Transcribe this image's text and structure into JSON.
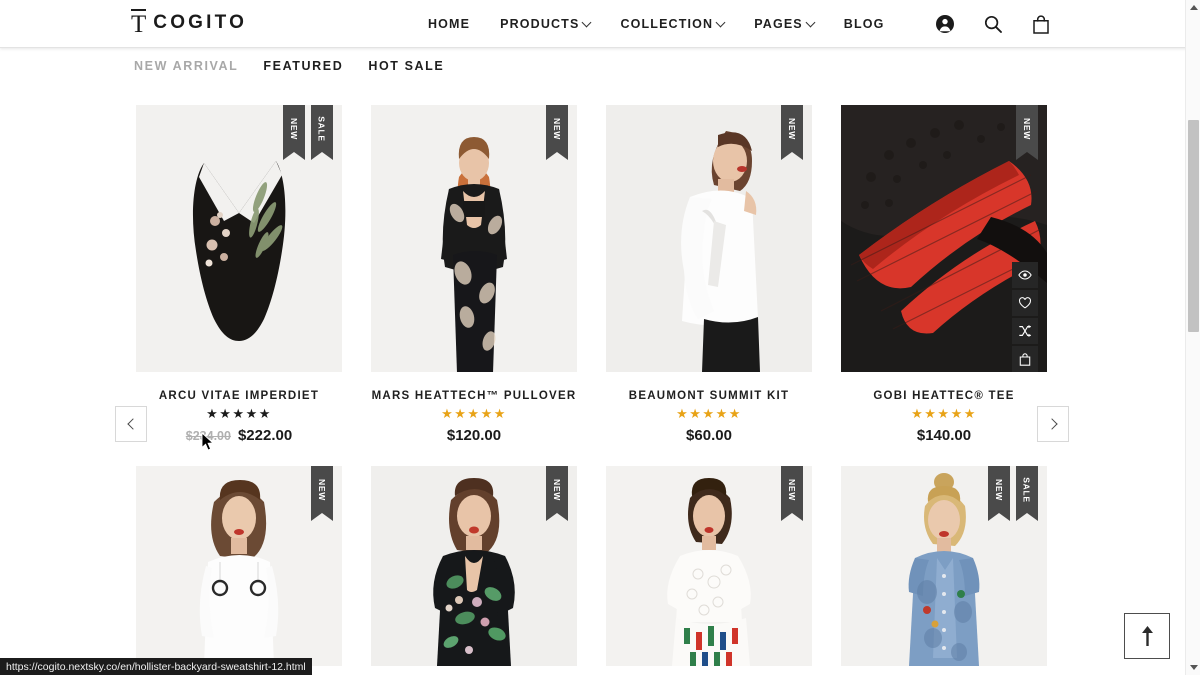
{
  "browser": {
    "status_url": "https://cogito.nextsky.co/en/hollister-backyard-sweatshirt-12.html"
  },
  "header": {
    "logo_mark": "T",
    "logo_text": "COGITO",
    "nav": [
      {
        "label": "HOME",
        "has_dropdown": false
      },
      {
        "label": "PRODUCTS",
        "has_dropdown": true
      },
      {
        "label": "COLLECTION",
        "has_dropdown": true
      },
      {
        "label": "PAGES",
        "has_dropdown": true
      },
      {
        "label": "BLOG",
        "has_dropdown": false
      }
    ],
    "icons": [
      {
        "name": "account-icon",
        "label": "Account"
      },
      {
        "name": "search-icon",
        "label": "Search"
      },
      {
        "name": "cart-icon",
        "label": "Cart"
      }
    ]
  },
  "tabs": [
    {
      "label": "NEW ARRIVAL",
      "active": false
    },
    {
      "label": "FEATURED",
      "active": true
    },
    {
      "label": "HOT SALE",
      "active": true
    }
  ],
  "carousel": {
    "prev_label": "‹",
    "next_label": "›"
  },
  "products_row1": [
    {
      "title": "ARCU VITAE IMPERDIET",
      "stars": "★★★★★",
      "star_color": "dark",
      "old_price": "$234.00",
      "price": "$222.00",
      "badges": [
        "NEW",
        "SALE"
      ],
      "show_actions": false
    },
    {
      "title": "MARS HEATTECH™ PULLOVER",
      "stars": "★★★★★",
      "star_color": "gold",
      "old_price": "",
      "price": "$120.00",
      "badges": [
        "NEW"
      ],
      "show_actions": false
    },
    {
      "title": "BEAUMONT SUMMIT KIT",
      "stars": "★★★★★",
      "star_color": "gold",
      "old_price": "",
      "price": "$60.00",
      "badges": [
        "NEW"
      ],
      "show_actions": false
    },
    {
      "title": "GOBI HEATTEC® TEE",
      "stars": "★★★★★",
      "star_color": "gold",
      "old_price": "",
      "price": "$140.00",
      "badges": [
        "NEW"
      ],
      "show_actions": true
    }
  ],
  "products_row2": [
    {
      "badges": [
        "NEW"
      ]
    },
    {
      "badges": [
        "NEW"
      ]
    },
    {
      "badges": [
        "NEW"
      ]
    },
    {
      "badges": [
        "NEW",
        "SALE"
      ]
    }
  ],
  "hover_actions": [
    {
      "name": "quick-view-icon",
      "label": "Quick view"
    },
    {
      "name": "wishlist-heart-icon",
      "label": "Add to wishlist"
    },
    {
      "name": "compare-shuffle-icon",
      "label": "Compare"
    },
    {
      "name": "add-to-cart-bag-icon",
      "label": "Add to cart"
    }
  ],
  "back_to_top": {
    "name": "arrow-up-icon",
    "label": "Back to top"
  },
  "colors": {
    "badge_bg": "#4a4a4a",
    "action_bg": "#262626",
    "star_gold": "#e8a317",
    "thumb_bg": "#f2f1ef",
    "text_dark": "#1f1f1f",
    "text_muted": "#a8a8a8"
  }
}
